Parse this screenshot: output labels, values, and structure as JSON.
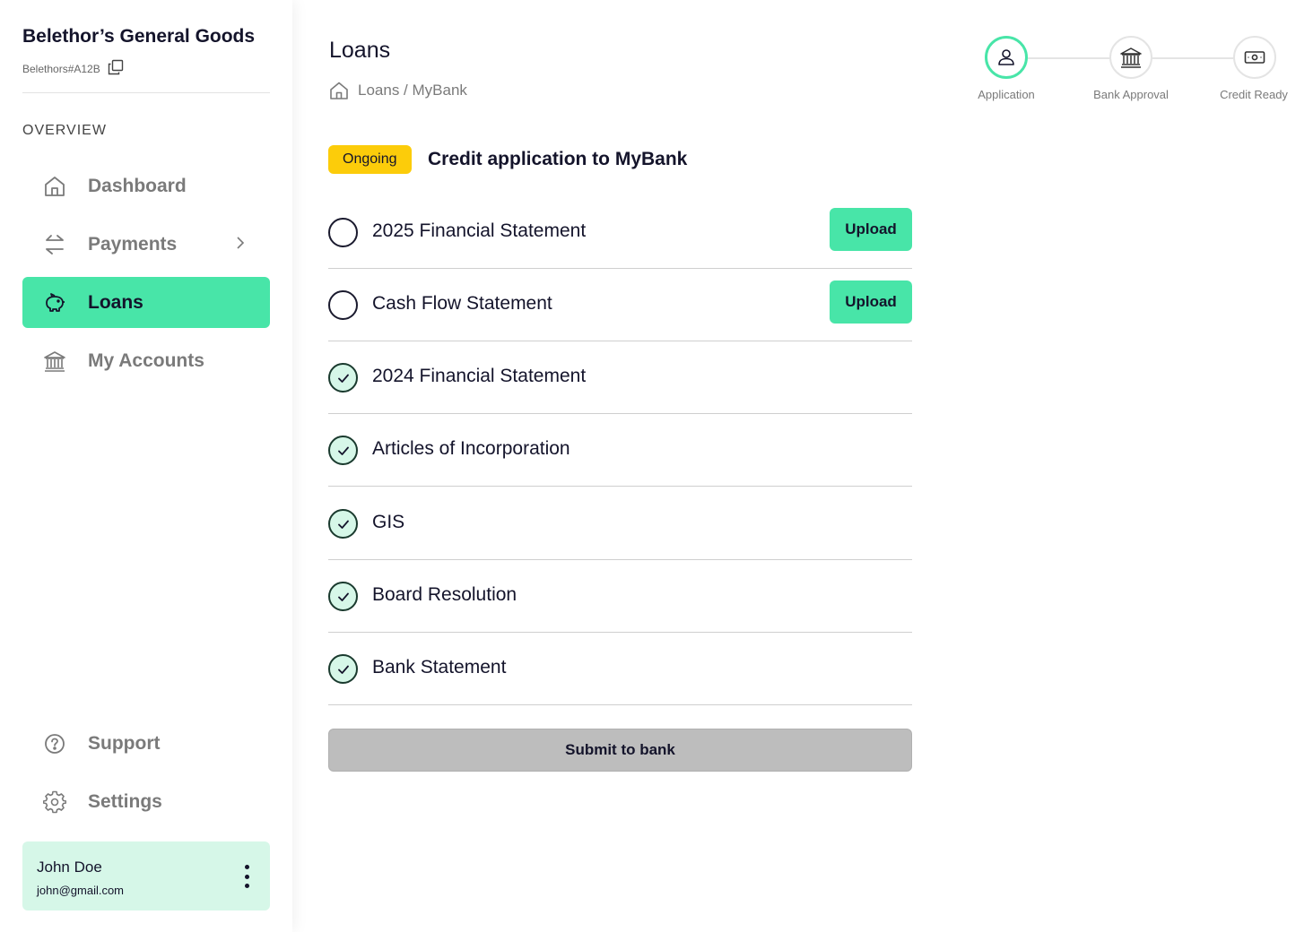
{
  "sidebar": {
    "brand_name": "Belethor’s General Goods",
    "brand_id": "Belethors#A12B",
    "section_label": "OVERVIEW",
    "items": [
      {
        "label": "Dashboard",
        "icon": "home-icon"
      },
      {
        "label": "Payments",
        "icon": "transfer-arrows-icon"
      },
      {
        "label": "Loans",
        "icon": "piggy-bank-icon"
      },
      {
        "label": "My Accounts",
        "icon": "bank-icon"
      }
    ],
    "footer_items": [
      {
        "label": "Support",
        "icon": "help-circle-icon"
      },
      {
        "label": "Settings",
        "icon": "gear-icon"
      }
    ],
    "user": {
      "name": "John Doe",
      "email": "john@gmail.com"
    },
    "accent_color": "#48e5a8"
  },
  "main": {
    "title": "Loans",
    "breadcrumb": "Loans / MyBank",
    "status_badge": "Ongoing",
    "status_color": "#fccc0a",
    "heading": "Credit application to MyBank",
    "documents": [
      {
        "label": "2025 Financial Statement",
        "status": "pending",
        "action": "Upload"
      },
      {
        "label": "Cash Flow Statement",
        "status": "pending",
        "action": "Upload"
      },
      {
        "label": "2024 Financial Statement",
        "status": "done"
      },
      {
        "label": "Articles of Incorporation",
        "status": "done"
      },
      {
        "label": "GIS",
        "status": "done"
      },
      {
        "label": "Board Resolution",
        "status": "done"
      },
      {
        "label": "Bank Statement",
        "status": "done"
      }
    ],
    "submit_label": "Submit to bank"
  },
  "stepper": {
    "steps": [
      {
        "label": "Application",
        "icon": "user-icon",
        "active": true
      },
      {
        "label": "Bank Approval",
        "icon": "bank-icon",
        "active": false
      },
      {
        "label": "Credit Ready",
        "icon": "cash-icon",
        "active": false
      }
    ]
  }
}
